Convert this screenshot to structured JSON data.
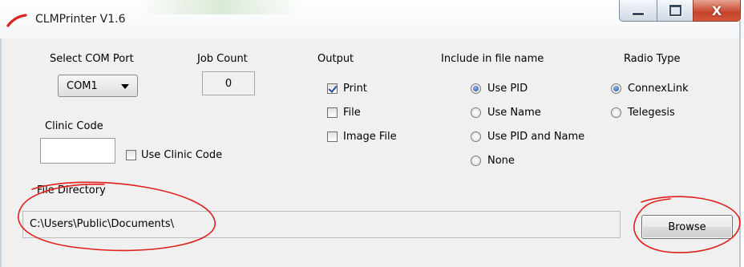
{
  "window": {
    "title": "CLMPrinter V1.6",
    "close_glyph": "X",
    "icons": {
      "app": "app-swoosh-icon",
      "minimize": "minimize-icon",
      "maximize": "maximize-icon",
      "close": "close-icon"
    }
  },
  "com_port": {
    "label": "Select COM Port",
    "selected": "COM1"
  },
  "job_count": {
    "label": "Job Count",
    "value": "0"
  },
  "clinic": {
    "label": "Clinic Code",
    "value": "",
    "use_label": "Use Clinic Code",
    "use_checked": false
  },
  "output": {
    "label": "Output",
    "options": [
      {
        "label": "Print",
        "checked": true
      },
      {
        "label": "File",
        "checked": false
      },
      {
        "label": "Image File",
        "checked": false
      }
    ]
  },
  "include_in_file_name": {
    "label": "Include in file name",
    "options": [
      {
        "label": "Use PID",
        "selected": true
      },
      {
        "label": "Use Name",
        "selected": false
      },
      {
        "label": "Use PID and Name",
        "selected": false
      },
      {
        "label": "None",
        "selected": false
      }
    ]
  },
  "radio_type": {
    "label": "Radio Type",
    "options": [
      {
        "label": "ConnexLink",
        "selected": true
      },
      {
        "label": "Telegesis",
        "selected": false
      }
    ]
  },
  "file_directory": {
    "label": "File Directory",
    "value": "C:\\Users\\Public\\Documents\\"
  },
  "browse_label": "Browse",
  "colors": {
    "annotation": "#e0201c",
    "dialog_bg": "#f0f0f0",
    "close_button": "#c5432a",
    "radio_dot": "#1d4f9f"
  }
}
